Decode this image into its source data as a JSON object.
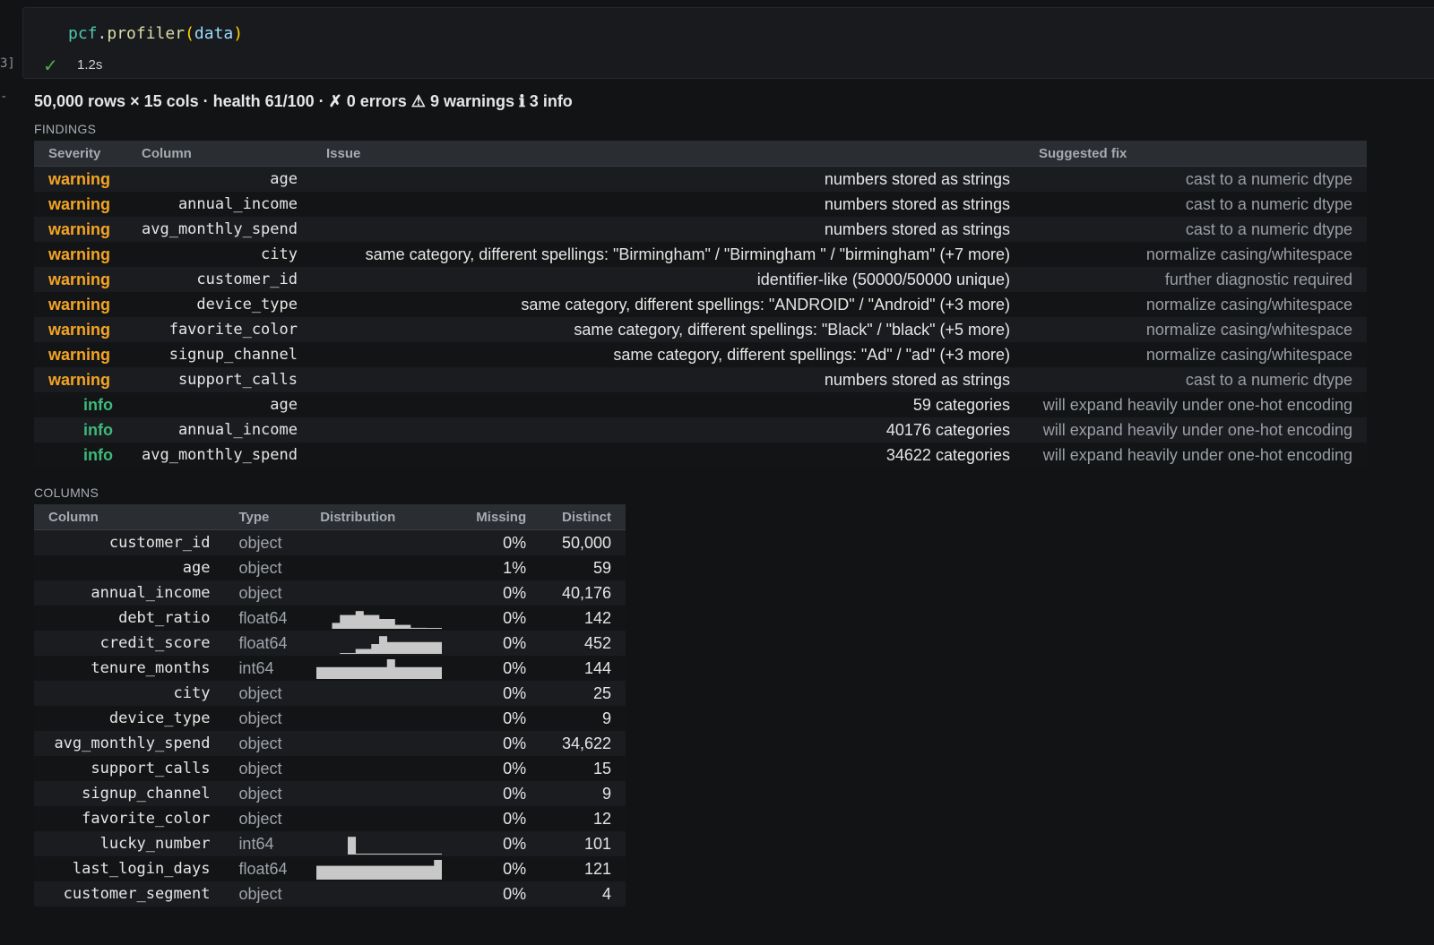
{
  "cell": {
    "gutter_label": "3]",
    "gutter_mark": "-",
    "code": {
      "var": "pcf",
      "dot": ".",
      "fn": "profiler",
      "open": "(",
      "arg": "data",
      "close": ")"
    },
    "status_icon": "check-icon",
    "elapsed": "1.2s"
  },
  "summary": "50,000 rows × 15 cols · health 61/100 · ✗ 0 errors ⚠ 9 warnings ℹ 3 info",
  "findings": {
    "section_label": "FINDINGS",
    "headers": [
      "Severity",
      "Column",
      "Issue",
      "Suggested fix"
    ],
    "rows": [
      {
        "severity": "warning",
        "column": "age",
        "issue": "numbers stored as strings",
        "fix": "cast to a numeric dtype"
      },
      {
        "severity": "warning",
        "column": "annual_income",
        "issue": "numbers stored as strings",
        "fix": "cast to a numeric dtype"
      },
      {
        "severity": "warning",
        "column": "avg_monthly_spend",
        "issue": "numbers stored as strings",
        "fix": "cast to a numeric dtype"
      },
      {
        "severity": "warning",
        "column": "city",
        "issue": "same category, different spellings: \"Birmingham\" / \"Birmingham \" / \"birmingham\" (+7 more)",
        "fix": "normalize casing/whitespace"
      },
      {
        "severity": "warning",
        "column": "customer_id",
        "issue": "identifier-like (50000/50000 unique)",
        "fix": "further diagnostic required"
      },
      {
        "severity": "warning",
        "column": "device_type",
        "issue": "same category, different spellings: \"ANDROID\" / \"Android\" (+3 more)",
        "fix": "normalize casing/whitespace"
      },
      {
        "severity": "warning",
        "column": "favorite_color",
        "issue": "same category, different spellings: \"Black\" / \"black\" (+5 more)",
        "fix": "normalize casing/whitespace"
      },
      {
        "severity": "warning",
        "column": "signup_channel",
        "issue": "same category, different spellings: \"Ad\" / \"ad\" (+3 more)",
        "fix": "normalize casing/whitespace"
      },
      {
        "severity": "warning",
        "column": "support_calls",
        "issue": "numbers stored as strings",
        "fix": "cast to a numeric dtype"
      },
      {
        "severity": "info",
        "column": "age",
        "issue": "59 categories",
        "fix": "will expand heavily under one-hot encoding"
      },
      {
        "severity": "info",
        "column": "annual_income",
        "issue": "40176 categories",
        "fix": "will expand heavily under one-hot encoding"
      },
      {
        "severity": "info",
        "column": "avg_monthly_spend",
        "issue": "34622 categories",
        "fix": "will expand heavily under one-hot encoding"
      }
    ]
  },
  "columns": {
    "section_label": "COLUMNS",
    "headers": [
      "Column",
      "Type",
      "Distribution",
      "Missing",
      "Distinct"
    ],
    "rows": [
      {
        "name": "customer_id",
        "type": "object",
        "missing": "0%",
        "distinct": "50,000",
        "hist": null
      },
      {
        "name": "age",
        "type": "object",
        "missing": "1%",
        "distinct": "59",
        "hist": null
      },
      {
        "name": "annual_income",
        "type": "object",
        "missing": "0%",
        "distinct": "40,176",
        "hist": null
      },
      {
        "name": "debt_ratio",
        "type": "float64",
        "missing": "0%",
        "distinct": "142",
        "hist": [
          0,
          0,
          0.3,
          0.7,
          0.7,
          0.9,
          0.7,
          0.7,
          0.5,
          0.5,
          0.2,
          0.2,
          0.05,
          0.05,
          0.02,
          0.02
        ]
      },
      {
        "name": "credit_score",
        "type": "float64",
        "missing": "0%",
        "distinct": "452",
        "hist": [
          0,
          0,
          0,
          0.02,
          0.02,
          0.25,
          0.25,
          0.5,
          0.9,
          0.6,
          0.6,
          0.6,
          0.6,
          0.6,
          0.6,
          0.6
        ]
      },
      {
        "name": "tenure_months",
        "type": "int64",
        "missing": "0%",
        "distinct": "144",
        "hist": [
          0.6,
          0.6,
          0.6,
          0.6,
          0.6,
          0.6,
          0.6,
          0.6,
          0.6,
          1.0,
          0.6,
          0.6,
          0.6,
          0.6,
          0.6,
          0.6
        ]
      },
      {
        "name": "city",
        "type": "object",
        "missing": "0%",
        "distinct": "25",
        "hist": null
      },
      {
        "name": "device_type",
        "type": "object",
        "missing": "0%",
        "distinct": "9",
        "hist": null
      },
      {
        "name": "avg_monthly_spend",
        "type": "object",
        "missing": "0%",
        "distinct": "34,622",
        "hist": null
      },
      {
        "name": "support_calls",
        "type": "object",
        "missing": "0%",
        "distinct": "15",
        "hist": null
      },
      {
        "name": "signup_channel",
        "type": "object",
        "missing": "0%",
        "distinct": "9",
        "hist": null
      },
      {
        "name": "favorite_color",
        "type": "object",
        "missing": "0%",
        "distinct": "12",
        "hist": null
      },
      {
        "name": "lucky_number",
        "type": "int64",
        "missing": "0%",
        "distinct": "101",
        "hist": [
          0,
          0,
          0,
          0,
          0.9,
          0.02,
          0.02,
          0.02,
          0.02,
          0.02,
          0.02,
          0.02,
          0.02,
          0.02,
          0.02,
          0.02
        ]
      },
      {
        "name": "last_login_days",
        "type": "float64",
        "missing": "0%",
        "distinct": "121",
        "hist": [
          0.7,
          0.7,
          0.7,
          0.7,
          0.7,
          0.7,
          0.7,
          0.7,
          0.7,
          0.7,
          0.7,
          0.7,
          0.7,
          0.7,
          0.7,
          1.0
        ]
      },
      {
        "name": "customer_segment",
        "type": "object",
        "missing": "0%",
        "distinct": "4",
        "hist": null
      }
    ]
  }
}
